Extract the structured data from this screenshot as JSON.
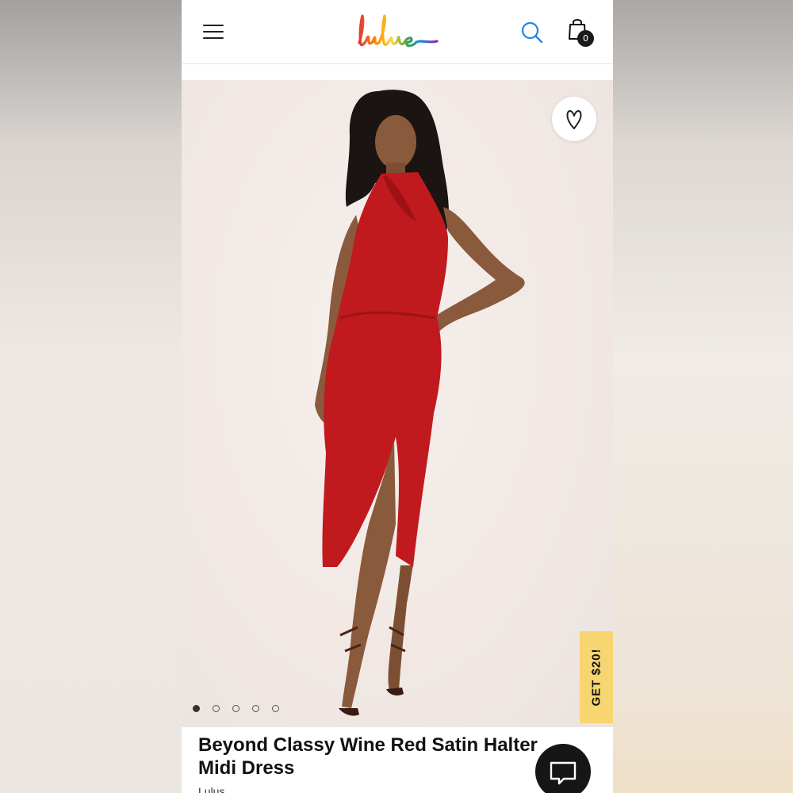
{
  "app": {
    "logo_text": "lulus"
  },
  "header": {
    "menu_icon": "hamburger-icon",
    "search_icon": "search-icon",
    "bag_icon": "shopping-bag-icon",
    "bag_count": "0"
  },
  "product": {
    "wishlist_icon": "heart-icon",
    "image_count": 5,
    "active_image": 1,
    "promo_label": "GET $20!",
    "title": "Beyond Classy Wine Red Satin Halter Midi Dress",
    "brand": "Lulus"
  },
  "chat": {
    "icon": "chat-bubble-icon"
  },
  "colors": {
    "dress": "#c01a1e",
    "promo": "#f7d570",
    "ink": "#111111"
  }
}
